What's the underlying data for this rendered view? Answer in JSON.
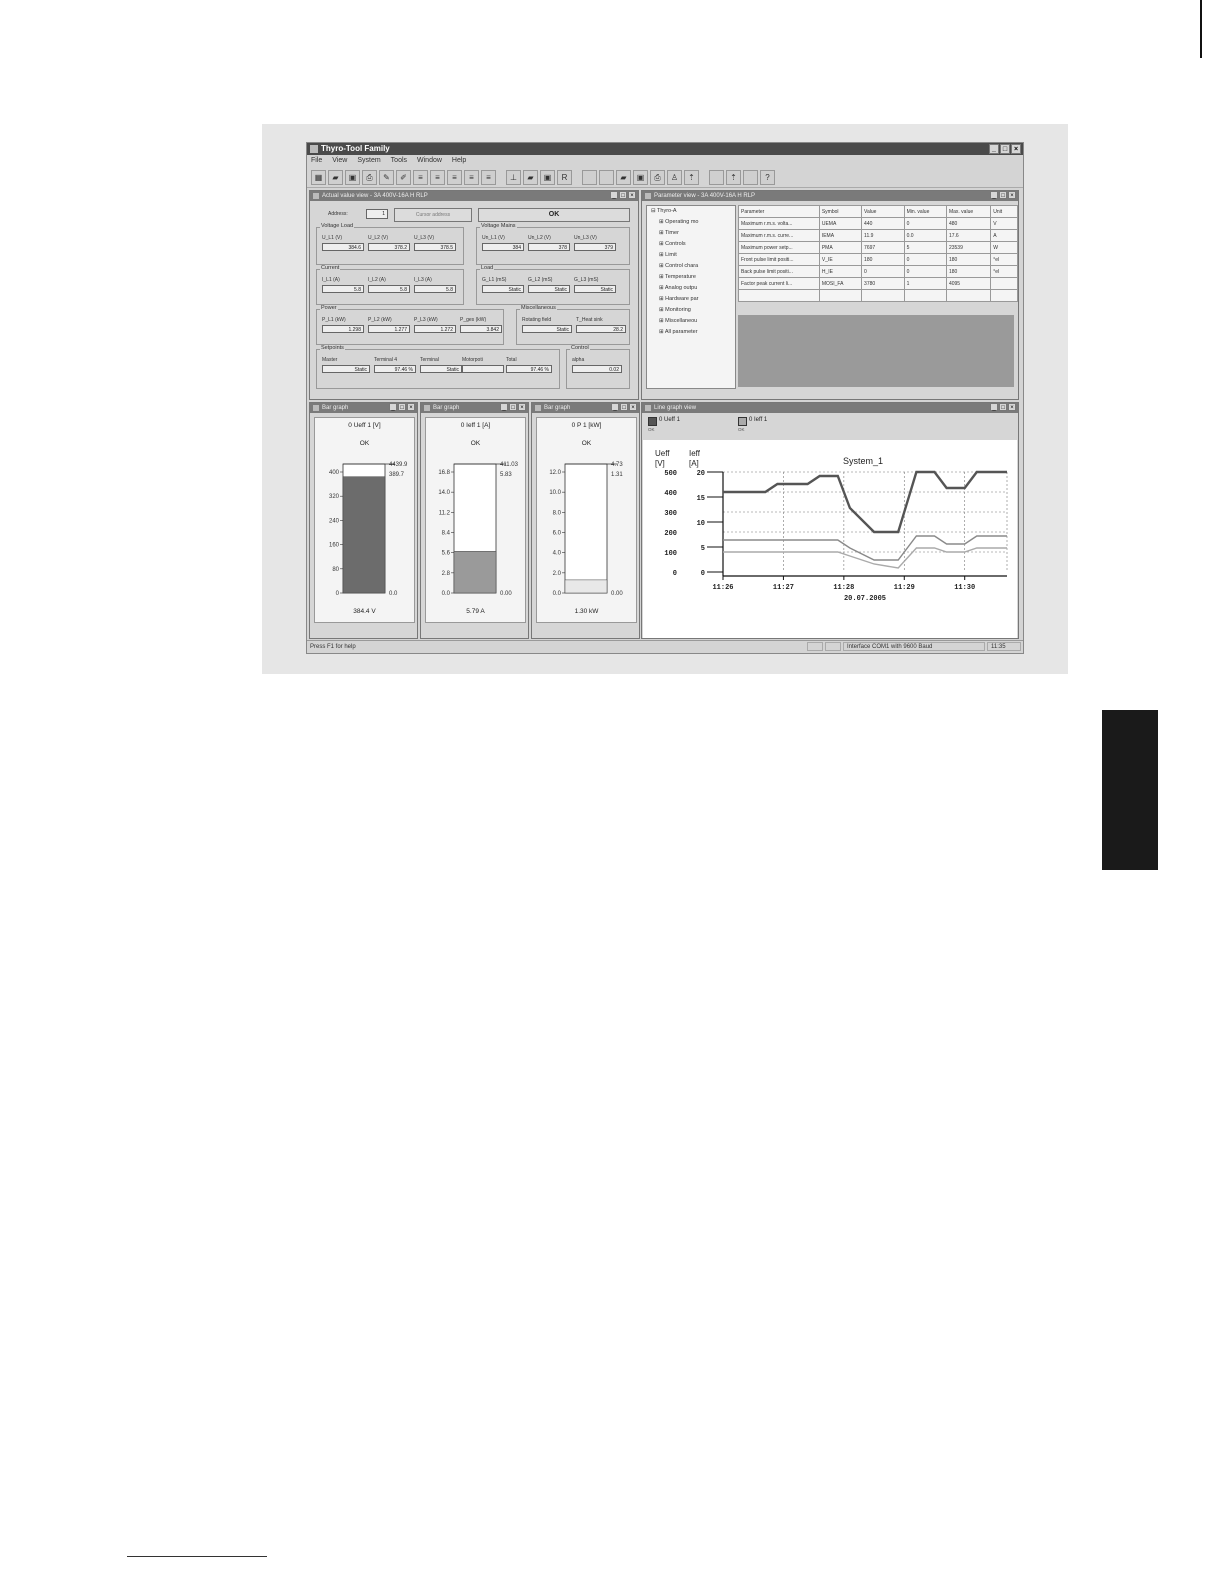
{
  "window": {
    "title": "Thyro-Tool Family"
  },
  "menu": [
    "File",
    "View",
    "System",
    "Tools",
    "Window",
    "Help"
  ],
  "toolbar_icons": [
    "grid-icon",
    "open-folder-icon",
    "save-icon",
    "print-icon",
    "settings-icon",
    "edit-icon",
    "text-a-icon",
    "text-b-icon",
    "text-c-icon",
    "text-d-icon",
    "text-e-icon",
    "chart-icon",
    "open-folder-icon",
    "save-icon",
    "r-icon",
    "blank-icon",
    "blank-icon",
    "open-folder-icon",
    "save-icon",
    "print-icon",
    "person-icon",
    "upload-icon",
    "blank-icon",
    "upload-icon",
    "blank-icon",
    "help-icon"
  ],
  "actual": {
    "title": "Actual value view - 3A 400V-16A H RLP",
    "address_label": "Address:",
    "address_value": "1",
    "cursor_button": "Cursor address",
    "ok_button": "OK",
    "groups": {
      "voltage_load": "Voltage Load",
      "voltage_mains": "Voltage Mains",
      "current": "Current",
      "load": "Load",
      "power": "Power",
      "misc": "Miscellaneous",
      "setpoints": "Setpoints",
      "control": "Control"
    },
    "fields": {
      "u_l1": {
        "label": "U_L1 (V)",
        "value": "384.6"
      },
      "u_l2": {
        "label": "U_L2 (V)",
        "value": "378.2"
      },
      "u_l3": {
        "label": "U_L3 (V)",
        "value": "378.5"
      },
      "un_l1": {
        "label": "Un_L1 (V)",
        "value": "384"
      },
      "un_l2": {
        "label": "Un_L2 (V)",
        "value": "378"
      },
      "un_l3": {
        "label": "Un_L3 (V)",
        "value": "379"
      },
      "i_l1": {
        "label": "I_L1 (A)",
        "value": "5.8"
      },
      "i_l2": {
        "label": "I_L2 (A)",
        "value": "5.8"
      },
      "i_l3": {
        "label": "I_L3 (A)",
        "value": "5.8"
      },
      "g_l1": {
        "label": "G_L1 (mS)",
        "value": "Static"
      },
      "g_l2": {
        "label": "G_L2 (mS)",
        "value": "Static"
      },
      "g_l3": {
        "label": "G_L3 (mS)",
        "value": "Static"
      },
      "p_l1": {
        "label": "P_L1 (kW)",
        "value": "1.298"
      },
      "p_l2": {
        "label": "P_L2 (kW)",
        "value": "1.277"
      },
      "p_l3": {
        "label": "P_L3 (kW)",
        "value": "1.272"
      },
      "p_ges": {
        "label": "P_ges (kW)",
        "value": "3.842"
      },
      "rot": {
        "label": "Rotating field",
        "value": "Static"
      },
      "theat": {
        "label": "T_Heat sink",
        "value": "28.2"
      },
      "master": {
        "label": "Master",
        "value": "Static"
      },
      "term4": {
        "label": "Terminal 4",
        "value": "97.46 %"
      },
      "terminal": {
        "label": "Terminal",
        "value": "Static"
      },
      "motorpoti": {
        "label": "Motorpoti",
        "value": ""
      },
      "total": {
        "label": "Total",
        "value": "97.46 %"
      },
      "alpha": {
        "label": "alpha",
        "value": "0.02"
      }
    }
  },
  "params": {
    "title": "Parameter view - 3A 400V-16A H RLP",
    "tree": [
      "Thyro-A",
      "Operating mo",
      "Timer",
      "Controls",
      "Limit",
      "Control chara",
      "Temperature",
      "Analog outpu",
      "Hardware par",
      "Monitoring",
      "Miscellaneou",
      "All parameter"
    ],
    "columns": [
      "Parameter",
      "Symbol",
      "Value",
      "Min. value",
      "Max. value",
      "Unit"
    ],
    "rows": [
      [
        "Maximum r.m.s. volta...",
        "UEMA",
        "440",
        "0",
        "480",
        "V"
      ],
      [
        "Maximum r.m.s. curre...",
        "IEMA",
        "11.9",
        "0.0",
        "17.6",
        "A"
      ],
      [
        "Maximum power setp...",
        "PMA",
        "7697",
        "5",
        "23539",
        "W"
      ],
      [
        "Front pulse limit positi...",
        "V_IE",
        "180",
        "0",
        "180",
        "°el"
      ],
      [
        "Back pulse limit positi...",
        "H_IE",
        "0",
        "0",
        "180",
        "°el"
      ],
      [
        "Factor peak current li...",
        "MOSI_FA",
        "3780",
        "1",
        "4095",
        ""
      ]
    ]
  },
  "bars": [
    {
      "title": "Bar graph",
      "channel": "0   Ueff 1 [V]",
      "status": "OK",
      "ticks": [
        "400",
        "320",
        "240",
        "160",
        "80",
        "0"
      ],
      "max": 400,
      "value": 384.4,
      "marker_top": "4439.9",
      "marker_second": "389.7",
      "marker_low": "0.0",
      "readout": "384.4 V",
      "fill": "#6c6c6c"
    },
    {
      "title": "Bar graph",
      "channel": "0   Ieff 1 [A]",
      "status": "OK",
      "ticks": [
        "16.8",
        "14.0",
        "11.2",
        "8.4",
        "5.6",
        "2.8",
        "0.0"
      ],
      "max": 16.8,
      "value": 5.79,
      "marker_top": "411.03",
      "marker_second": "5.83",
      "marker_low": "0.00",
      "readout": "5.79 A",
      "fill": "#9a9a9a"
    },
    {
      "title": "Bar graph",
      "channel": "0   P 1 [kW]",
      "status": "OK",
      "ticks": [
        "12.0",
        "10.0",
        "8.0",
        "6.0",
        "4.0",
        "2.0",
        "0.0"
      ],
      "max": 12.0,
      "value": 1.3,
      "marker_top": "4.73",
      "marker_second": "1.31",
      "marker_low": "0.00",
      "readout": "1.30 kW",
      "fill": "#e8e8e8"
    }
  ],
  "linegraph": {
    "title": "Line graph view",
    "legend": [
      {
        "name": "0   Ueff 1",
        "status": "OK",
        "color": "#555555"
      },
      {
        "name": "0   Ieff 1",
        "status": "OK",
        "color": "#aaaaaa"
      }
    ],
    "chart_data": {
      "type": "line",
      "title": "System_1",
      "ylabel_left": "Ueff [V]",
      "ylabel_right": "Ieff [A]",
      "y_left_ticks": [
        "500",
        "400",
        "300",
        "200",
        "100",
        "0"
      ],
      "y_right_ticks": [
        "20",
        "15",
        "10",
        "5",
        "0"
      ],
      "x_ticks": [
        "11:26",
        "11:27",
        "11:28",
        "11:29",
        "11:30"
      ],
      "xlabel": "20.07.2005",
      "x": [
        0,
        0.7,
        0.9,
        1.4,
        1.6,
        1.9,
        2.1,
        2.5,
        2.9,
        3.2,
        3.5,
        3.7,
        4.0,
        4.2,
        4.7
      ],
      "series": [
        {
          "name": "Ueff 1",
          "color": "#555555",
          "values": [
            20,
            20,
            22,
            22,
            24,
            24,
            16,
            10,
            10,
            25,
            25,
            21,
            21,
            25,
            25
          ]
        },
        {
          "name": "Ieff 1",
          "color": "#aaaaaa",
          "values": [
            5,
            5,
            5,
            5,
            5,
            5,
            4,
            2,
            1,
            6,
            6,
            5,
            5,
            6,
            6
          ]
        },
        {
          "name": "",
          "color": "#8a8a8a",
          "values": [
            8,
            8,
            8,
            8,
            8,
            8,
            6,
            3,
            3,
            9,
            9,
            7,
            7,
            9,
            9
          ]
        }
      ]
    }
  },
  "statusbar": {
    "help": "Press F1 for help",
    "interface": "Interface COM1 with 9600 Baud",
    "time": "11:35"
  }
}
